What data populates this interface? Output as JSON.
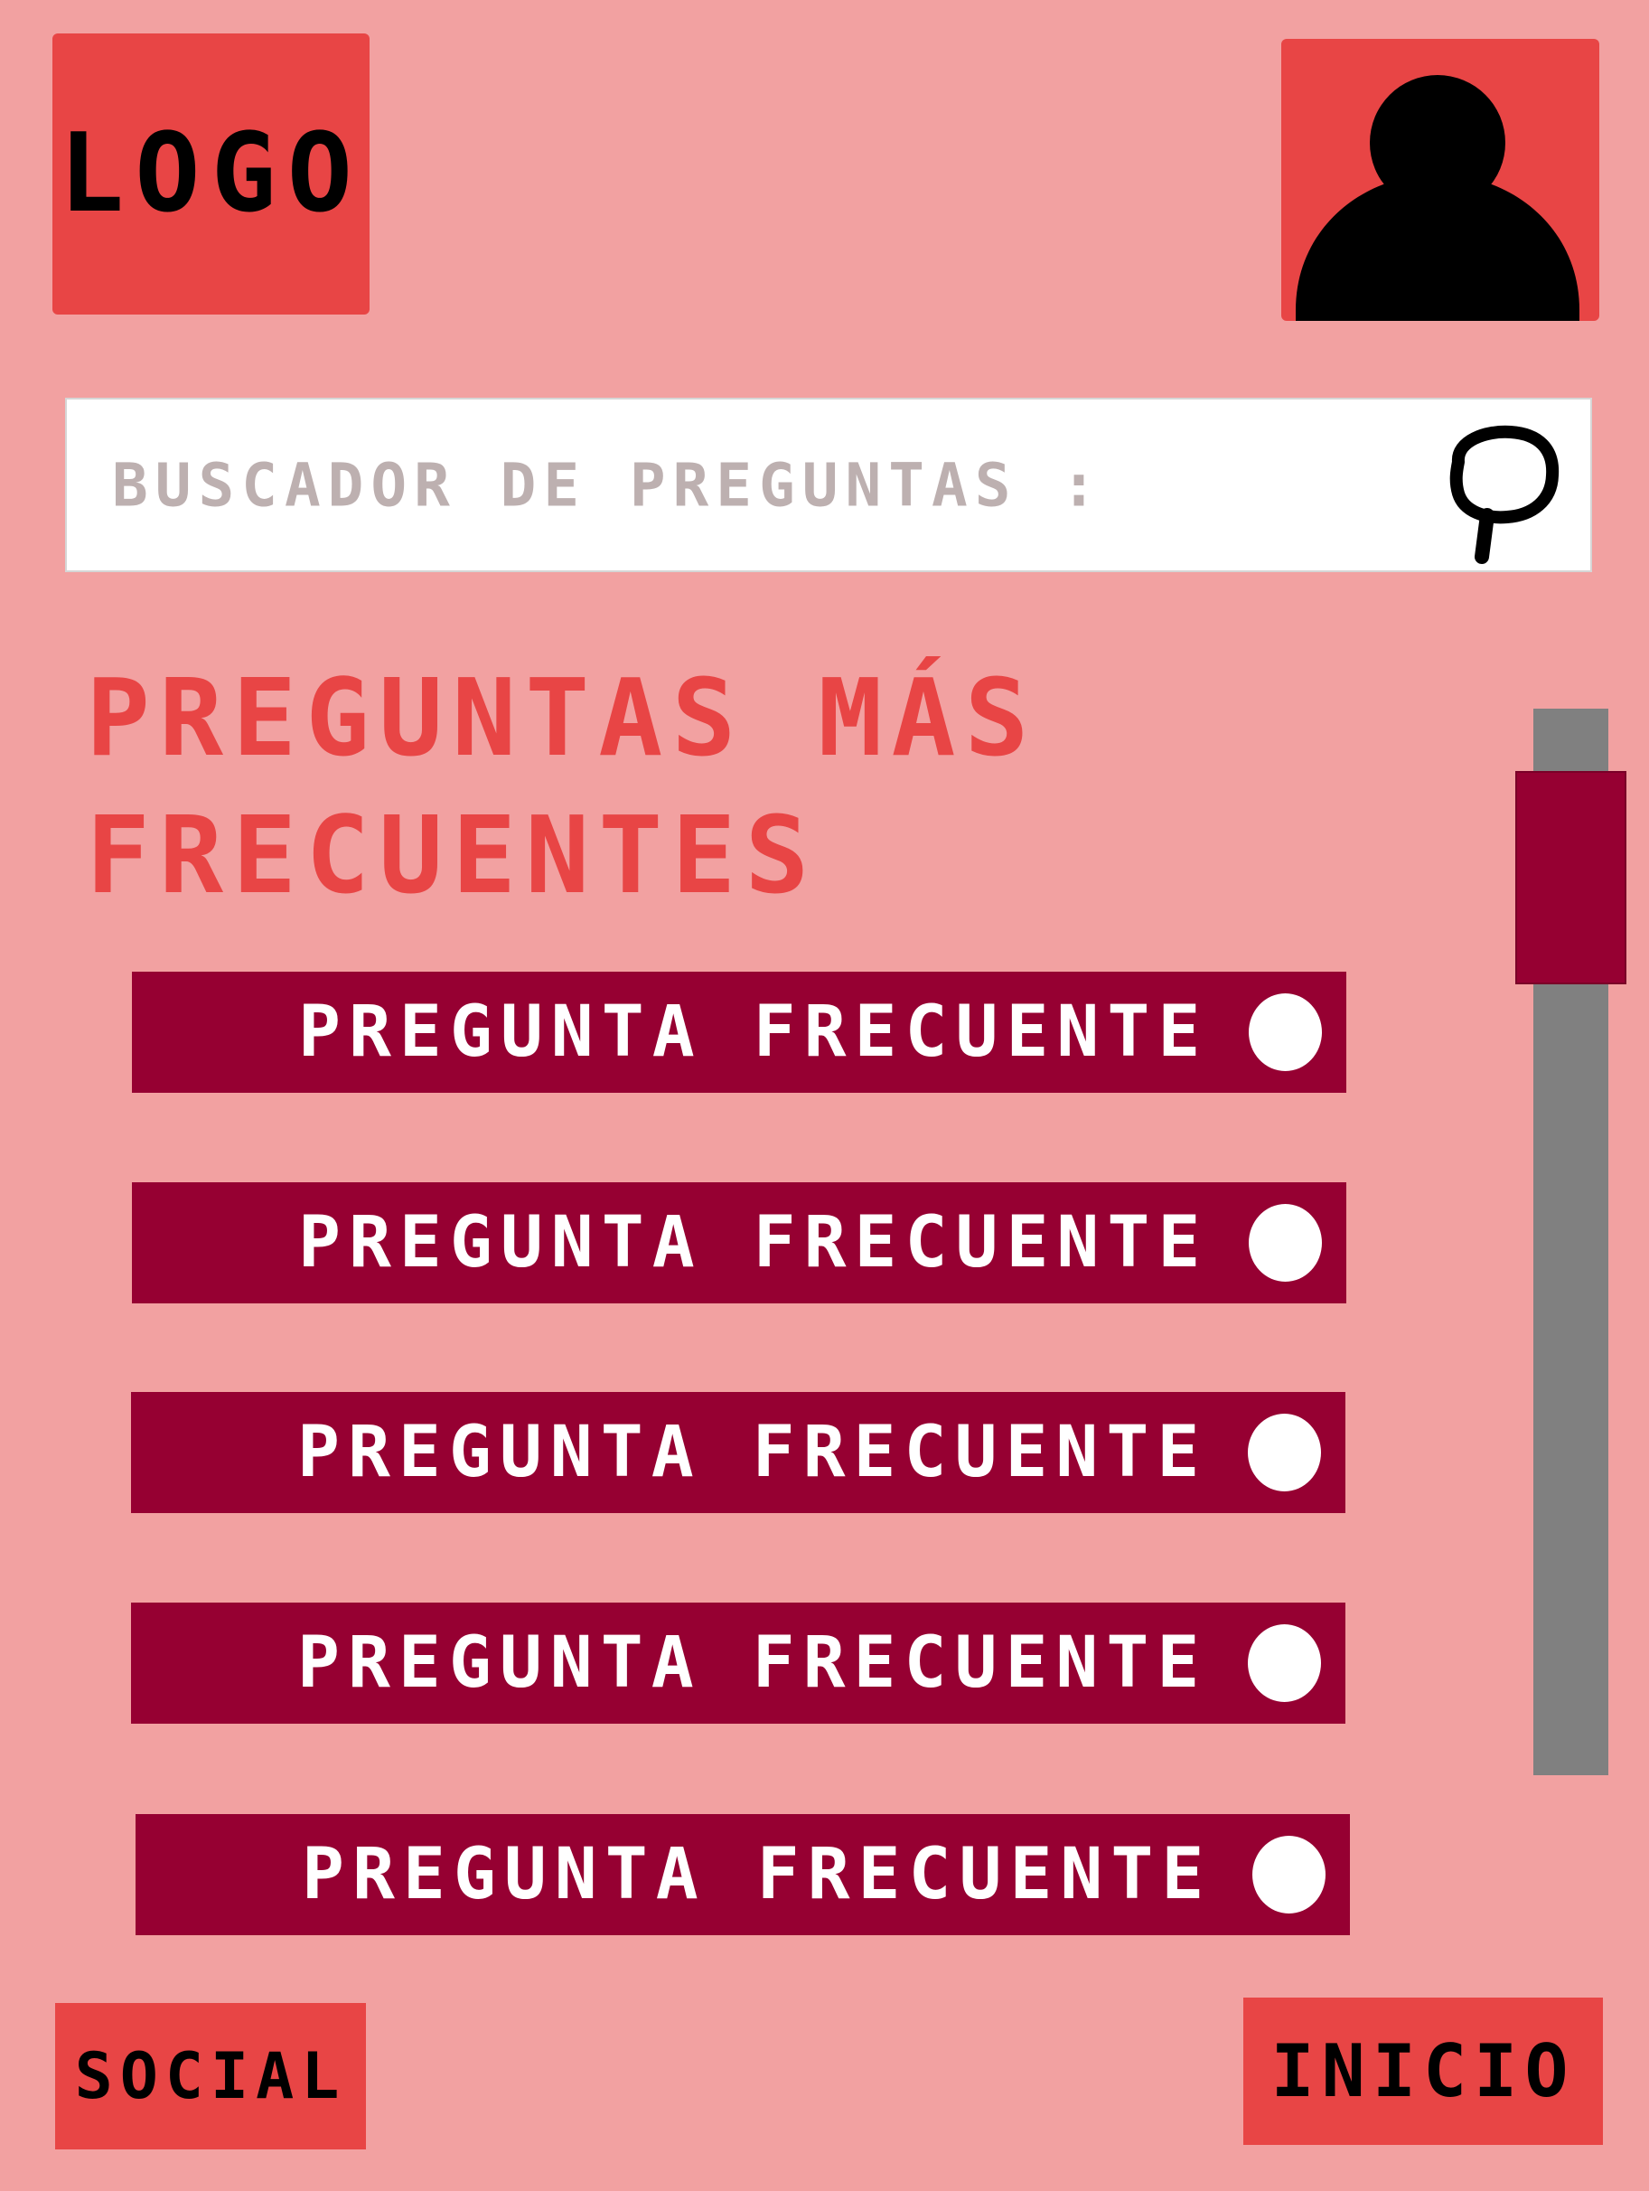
{
  "header": {
    "logo_text": "LOGO",
    "avatar_icon": "user-avatar-icon"
  },
  "search": {
    "placeholder": "BUSCADOR DE PREGUNTAS :",
    "value": "",
    "icon": "search-icon"
  },
  "faq": {
    "title": "PREGUNTAS MÁS FRECUENTES",
    "items": [
      {
        "label": "PREGUNTA FRECUENTE"
      },
      {
        "label": "PREGUNTA FRECUENTE"
      },
      {
        "label": "PREGUNTA FRECUENTE"
      },
      {
        "label": "PREGUNTA FRECUENTE"
      },
      {
        "label": "PREGUNTA FRECUENTE"
      }
    ]
  },
  "footer": {
    "social_label": "SOCIAL",
    "home_label": "INICIO"
  },
  "colors": {
    "background": "#f2a1a1",
    "accent": "#e84545",
    "item_bg": "#960032",
    "scroll_track": "#808080"
  }
}
